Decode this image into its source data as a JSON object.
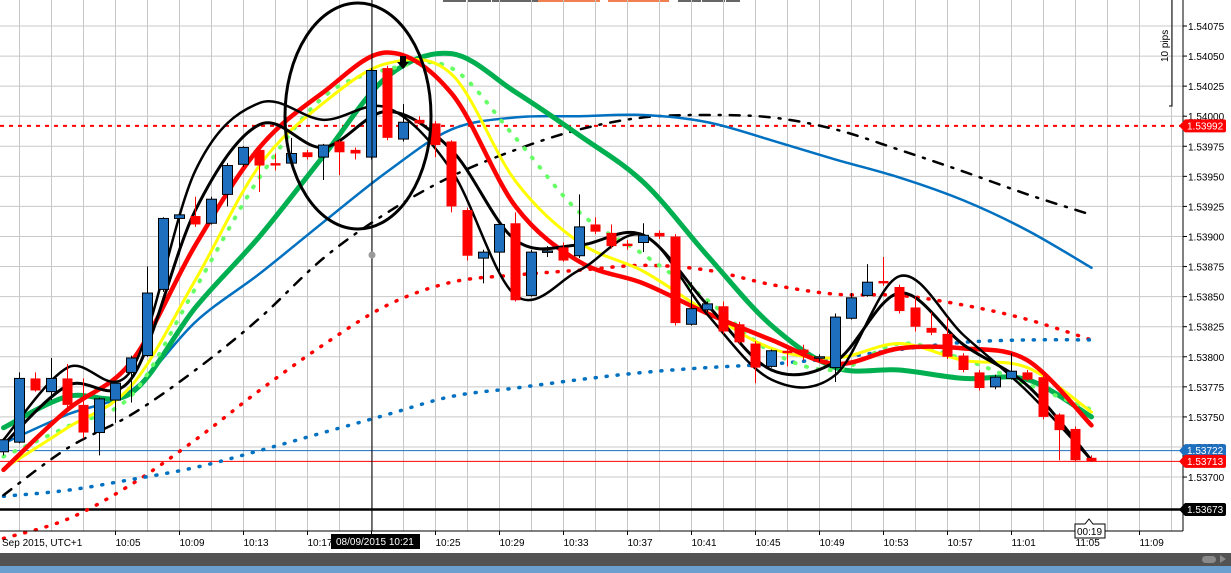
{
  "chart_data": {
    "type": "candlestick",
    "symbol_timeframe": "1 minute",
    "xlabel_prefix": "Sep 2015, UTC+1",
    "x_ticks": [
      "10:05",
      "10:09",
      "10:13",
      "10:17",
      "10:21",
      "10:25",
      "10:29",
      "10:33",
      "10:37",
      "10:41",
      "10:45",
      "10:49",
      "10:53",
      "10:57",
      "11:01",
      "11:05",
      "11:09"
    ],
    "y_ticks": [
      "1.54075",
      "1.54050",
      "1.54025",
      "1.54000",
      "1.53975",
      "1.53950",
      "1.53925",
      "1.53900",
      "1.53875",
      "1.53850",
      "1.53825",
      "1.53800",
      "1.53775",
      "1.53750",
      "1.53725",
      "1.53700"
    ],
    "ylim": [
      1.5364,
      1.541
    ],
    "grid": true,
    "colors": {
      "up": "#1f6fbf",
      "down": "#ff0000"
    },
    "candles_fields": [
      "time",
      "open",
      "high",
      "low",
      "close"
    ],
    "candles": [
      [
        "09:58",
        1.53721,
        1.53732,
        1.53718,
        1.53731
      ],
      [
        "09:59",
        1.53729,
        1.53787,
        1.53728,
        1.53782
      ],
      [
        "10:00",
        1.53782,
        1.53787,
        1.53771,
        1.53772
      ],
      [
        "10:01",
        1.53771,
        1.53799,
        1.53764,
        1.53782
      ],
      [
        "10:02",
        1.53782,
        1.53794,
        1.53758,
        1.5376
      ],
      [
        "10:03",
        1.5376,
        1.53782,
        1.53732,
        1.53737
      ],
      [
        "10:04",
        1.53737,
        1.53766,
        1.53718,
        1.53765
      ],
      [
        "10:05",
        1.53764,
        1.5378,
        1.53745,
        1.53778
      ],
      [
        "10:06",
        1.53787,
        1.53801,
        1.53762,
        1.53799
      ],
      [
        "10:07",
        1.53801,
        1.53875,
        1.538,
        1.53853
      ],
      [
        "10:08",
        1.53856,
        1.53916,
        1.53854,
        1.53915
      ],
      [
        "10:09",
        1.53915,
        1.5392,
        1.53885,
        1.53918
      ],
      [
        "10:10",
        1.53917,
        1.53933,
        1.53908,
        1.5391
      ],
      [
        "10:11",
        1.53911,
        1.53933,
        1.5391,
        1.53931
      ],
      [
        "10:12",
        1.53935,
        1.53961,
        1.53925,
        1.53959
      ],
      [
        "10:13",
        1.5396,
        1.53975,
        1.53958,
        1.53974
      ],
      [
        "10:14",
        1.53972,
        1.53974,
        1.53937,
        1.53959
      ],
      [
        "10:15",
        1.53961,
        1.53969,
        1.53955,
        1.53959
      ],
      [
        "10:16",
        1.53961,
        1.53982,
        1.53959,
        1.53969
      ],
      [
        "10:17",
        1.5397,
        1.53972,
        1.53964,
        1.53966
      ],
      [
        "10:18",
        1.53966,
        1.53977,
        1.53947,
        1.53976
      ],
      [
        "10:19",
        1.53979,
        1.5398,
        1.53951,
        1.5397
      ],
      [
        "10:20",
        1.53972,
        1.53974,
        1.53964,
        1.53969
      ],
      [
        "10:21",
        1.53966,
        1.5404,
        1.53964,
        1.54038
      ],
      [
        "10:22",
        1.5404,
        1.54042,
        1.5398,
        1.53982
      ],
      [
        "10:23",
        1.53981,
        1.5401,
        1.53979,
        1.53995
      ],
      [
        "10:24",
        1.53997,
        1.54,
        1.53993,
        1.53994
      ],
      [
        "10:25",
        1.53994,
        1.53996,
        1.53966,
        1.53976
      ],
      [
        "10:26",
        1.53979,
        1.5398,
        1.5392,
        1.53925
      ],
      [
        "10:27",
        1.53922,
        1.53924,
        1.5388,
        1.53884
      ],
      [
        "10:28",
        1.53882,
        1.53889,
        1.53861,
        1.53887
      ],
      [
        "10:29",
        1.53887,
        1.53911,
        1.5387,
        1.5391
      ],
      [
        "10:30",
        1.53911,
        1.5392,
        1.53846,
        1.53847
      ],
      [
        "10:31",
        1.53851,
        1.53889,
        1.5385,
        1.53887
      ],
      [
        "10:32",
        1.53887,
        1.53892,
        1.53883,
        1.53888
      ],
      [
        "10:33",
        1.53891,
        1.53895,
        1.53879,
        1.5388
      ],
      [
        "10:34",
        1.53884,
        1.53935,
        1.53882,
        1.53908
      ],
      [
        "10:35",
        1.5391,
        1.53916,
        1.53902,
        1.53904
      ],
      [
        "10:36",
        1.53903,
        1.5391,
        1.5389,
        1.53892
      ],
      [
        "10:37",
        1.53894,
        1.53897,
        1.53889,
        1.53892
      ],
      [
        "10:38",
        1.53895,
        1.53911,
        1.53887,
        1.53901
      ],
      [
        "10:39",
        1.53903,
        1.53905,
        1.53898,
        1.539
      ],
      [
        "10:40",
        1.539,
        1.53902,
        1.53826,
        1.53828
      ],
      [
        "10:41",
        1.53827,
        1.53862,
        1.53826,
        1.5384
      ],
      [
        "10:42",
        1.53839,
        1.53846,
        1.53837,
        1.53844
      ],
      [
        "10:43",
        1.53842,
        1.53846,
        1.53819,
        1.53821
      ],
      [
        "10:44",
        1.53827,
        1.53829,
        1.53811,
        1.53812
      ],
      [
        "10:45",
        1.53811,
        1.53813,
        1.53778,
        1.53791
      ],
      [
        "10:46",
        1.53792,
        1.53806,
        1.53791,
        1.53805
      ],
      [
        "10:47",
        1.53805,
        1.5381,
        1.53792,
        1.53803
      ],
      [
        "10:48",
        1.53806,
        1.5381,
        1.53797,
        1.53803
      ],
      [
        "10:49",
        1.53799,
        1.53802,
        1.53796,
        1.538
      ],
      [
        "10:50",
        1.53791,
        1.53836,
        1.53779,
        1.53833
      ],
      [
        "10:51",
        1.53832,
        1.53853,
        1.53831,
        1.53849
      ],
      [
        "10:52",
        1.53851,
        1.53877,
        1.5385,
        1.53862
      ],
      [
        "10:53",
        1.53863,
        1.53883,
        1.53859,
        1.53861
      ],
      [
        "10:54",
        1.53858,
        1.5386,
        1.53836,
        1.53838
      ],
      [
        "10:55",
        1.53841,
        1.5385,
        1.53821,
        1.53825
      ],
      [
        "10:56",
        1.53824,
        1.53837,
        1.53818,
        1.5382
      ],
      [
        "10:57",
        1.53819,
        1.53832,
        1.53798,
        1.538
      ],
      [
        "10:58",
        1.53801,
        1.53803,
        1.53787,
        1.53789
      ],
      [
        "10:59",
        1.53787,
        1.53789,
        1.53772,
        1.53774
      ],
      [
        "11:00",
        1.53775,
        1.53785,
        1.53773,
        1.53783
      ],
      [
        "11:01",
        1.53782,
        1.53803,
        1.53781,
        1.53788
      ],
      [
        "11:02",
        1.53787,
        1.53789,
        1.5378,
        1.53781
      ],
      [
        "11:03",
        1.53783,
        1.53785,
        1.53748,
        1.5375
      ],
      [
        "11:04",
        1.53752,
        1.53753,
        1.53714,
        1.53739
      ],
      [
        "11:05",
        1.5374,
        1.53742,
        1.53713,
        1.53714
      ],
      [
        "11:06",
        1.53716,
        1.53718,
        1.53713,
        1.53713
      ]
    ],
    "line_x": [
      "09:58",
      "10:02",
      "10:06",
      "10:10",
      "10:14",
      "10:18",
      "10:22",
      "10:26",
      "10:30",
      "10:34",
      "10:38",
      "10:42",
      "10:46",
      "10:50",
      "10:54",
      "10:58",
      "11:02",
      "11:06"
    ],
    "series": [
      {
        "name": "red-dotted-ma",
        "color": "#ff0000",
        "style": "dotted",
        "values": [
          1.53649,
          1.53665,
          1.53694,
          1.53731,
          1.53772,
          1.5381,
          1.53843,
          1.53862,
          1.53868,
          1.53872,
          1.53876,
          1.53872,
          1.5386,
          1.53852,
          1.53851,
          1.53843,
          1.53831,
          1.53814
        ]
      },
      {
        "name": "blue-dotted-ma",
        "color": "#0070c0",
        "style": "dotted",
        "values": [
          1.53684,
          1.53689,
          1.53698,
          1.53708,
          1.53722,
          1.53737,
          1.53752,
          1.53767,
          1.53774,
          1.53781,
          1.53787,
          1.53791,
          1.53794,
          1.53799,
          1.53806,
          1.53812,
          1.53814,
          1.53814
        ]
      },
      {
        "name": "black-dashdot-ma",
        "color": "#000000",
        "style": "dashdot",
        "values": [
          1.53685,
          1.53724,
          1.53752,
          1.53789,
          1.53832,
          1.53882,
          1.5392,
          1.5395,
          1.53972,
          1.53989,
          1.53999,
          1.54001,
          1.53999,
          1.53989,
          1.53972,
          1.53954,
          1.53935,
          1.53918
        ]
      },
      {
        "name": "blue-ma",
        "color": "#0070c0",
        "style": "solid",
        "values": [
          1.53728,
          1.53752,
          1.53772,
          1.53829,
          1.53869,
          1.53912,
          1.53954,
          1.53989,
          1.53999,
          1.54,
          1.54001,
          1.53995,
          1.5398,
          1.53964,
          1.53949,
          1.5393,
          1.53905,
          1.53874
        ]
      },
      {
        "name": "green-ma",
        "color": "#00b050",
        "style": "thick",
        "values": [
          1.53741,
          1.53767,
          1.5377,
          1.53841,
          1.539,
          1.53967,
          1.54033,
          1.54052,
          1.5402,
          1.53984,
          1.53945,
          1.53884,
          1.53826,
          1.53791,
          1.53789,
          1.53782,
          1.53781,
          1.5375
        ]
      },
      {
        "name": "light-green-dotted-ma",
        "color": "#66ff66",
        "style": "crosses",
        "values": [
          1.53717,
          1.53742,
          1.53768,
          1.53857,
          1.53949,
          1.54016,
          1.54039,
          1.5404,
          1.53982,
          1.5392,
          1.53885,
          1.53847,
          1.53804,
          1.53789,
          1.53811,
          1.53798,
          1.53777,
          1.53756
        ]
      },
      {
        "name": "yellow-ma",
        "color": "#ffff00",
        "style": "solid",
        "values": [
          1.53707,
          1.53741,
          1.53776,
          1.53864,
          1.53959,
          1.54011,
          1.54044,
          1.54035,
          1.53946,
          1.53895,
          1.53871,
          1.53837,
          1.53807,
          1.53799,
          1.53811,
          1.53797,
          1.53791,
          1.53754
        ]
      },
      {
        "name": "red-ma",
        "color": "#ff0000",
        "style": "thick",
        "values": [
          1.53706,
          1.53756,
          1.53796,
          1.53893,
          1.53974,
          1.5402,
          1.54053,
          1.54019,
          1.53925,
          1.53879,
          1.53861,
          1.53836,
          1.53814,
          1.53794,
          1.53807,
          1.53807,
          1.53797,
          1.53743
        ]
      },
      {
        "name": "black-slow-line",
        "color": "#000000",
        "style": "solid",
        "values": [
          1.53727,
          1.53776,
          1.53782,
          1.53922,
          1.53993,
          1.53974,
          1.54004,
          1.53972,
          1.53897,
          1.53893,
          1.53901,
          1.53843,
          1.53789,
          1.53796,
          1.53853,
          1.5381,
          1.53776,
          1.53714
        ]
      },
      {
        "name": "black-fast-line",
        "color": "#000000",
        "style": "solid",
        "values": [
          1.53731,
          1.53791,
          1.53789,
          1.53955,
          1.54011,
          1.53997,
          1.54007,
          1.53955,
          1.53851,
          1.53872,
          1.53901,
          1.53835,
          1.53781,
          1.53785,
          1.53867,
          1.53818,
          1.53771,
          1.53714
        ]
      }
    ],
    "horizontal_lines": [
      {
        "name": "resistance-line",
        "price": 1.53992,
        "label": "1.53992",
        "color": "#ff0000",
        "style": "dotted"
      },
      {
        "name": "ask-line",
        "price": 1.53722,
        "label": "1.53722",
        "color": "#1f6fbf",
        "style": "thin"
      },
      {
        "name": "bid-line",
        "price": 1.53713,
        "label": "1.53713",
        "color": "#ff0000",
        "style": "thin"
      },
      {
        "name": "support-line",
        "price": 1.53673,
        "label": "1.53673",
        "color": "#000000",
        "style": "thick"
      }
    ],
    "crosshair": {
      "time": "10:21",
      "label": "08/09/2015 10:21"
    },
    "candle_timer": "00:19",
    "ruler_label": "10 pips",
    "annotations": [
      "ellipse around 10:14–10:25 top",
      "down arrow at 10:23"
    ]
  }
}
